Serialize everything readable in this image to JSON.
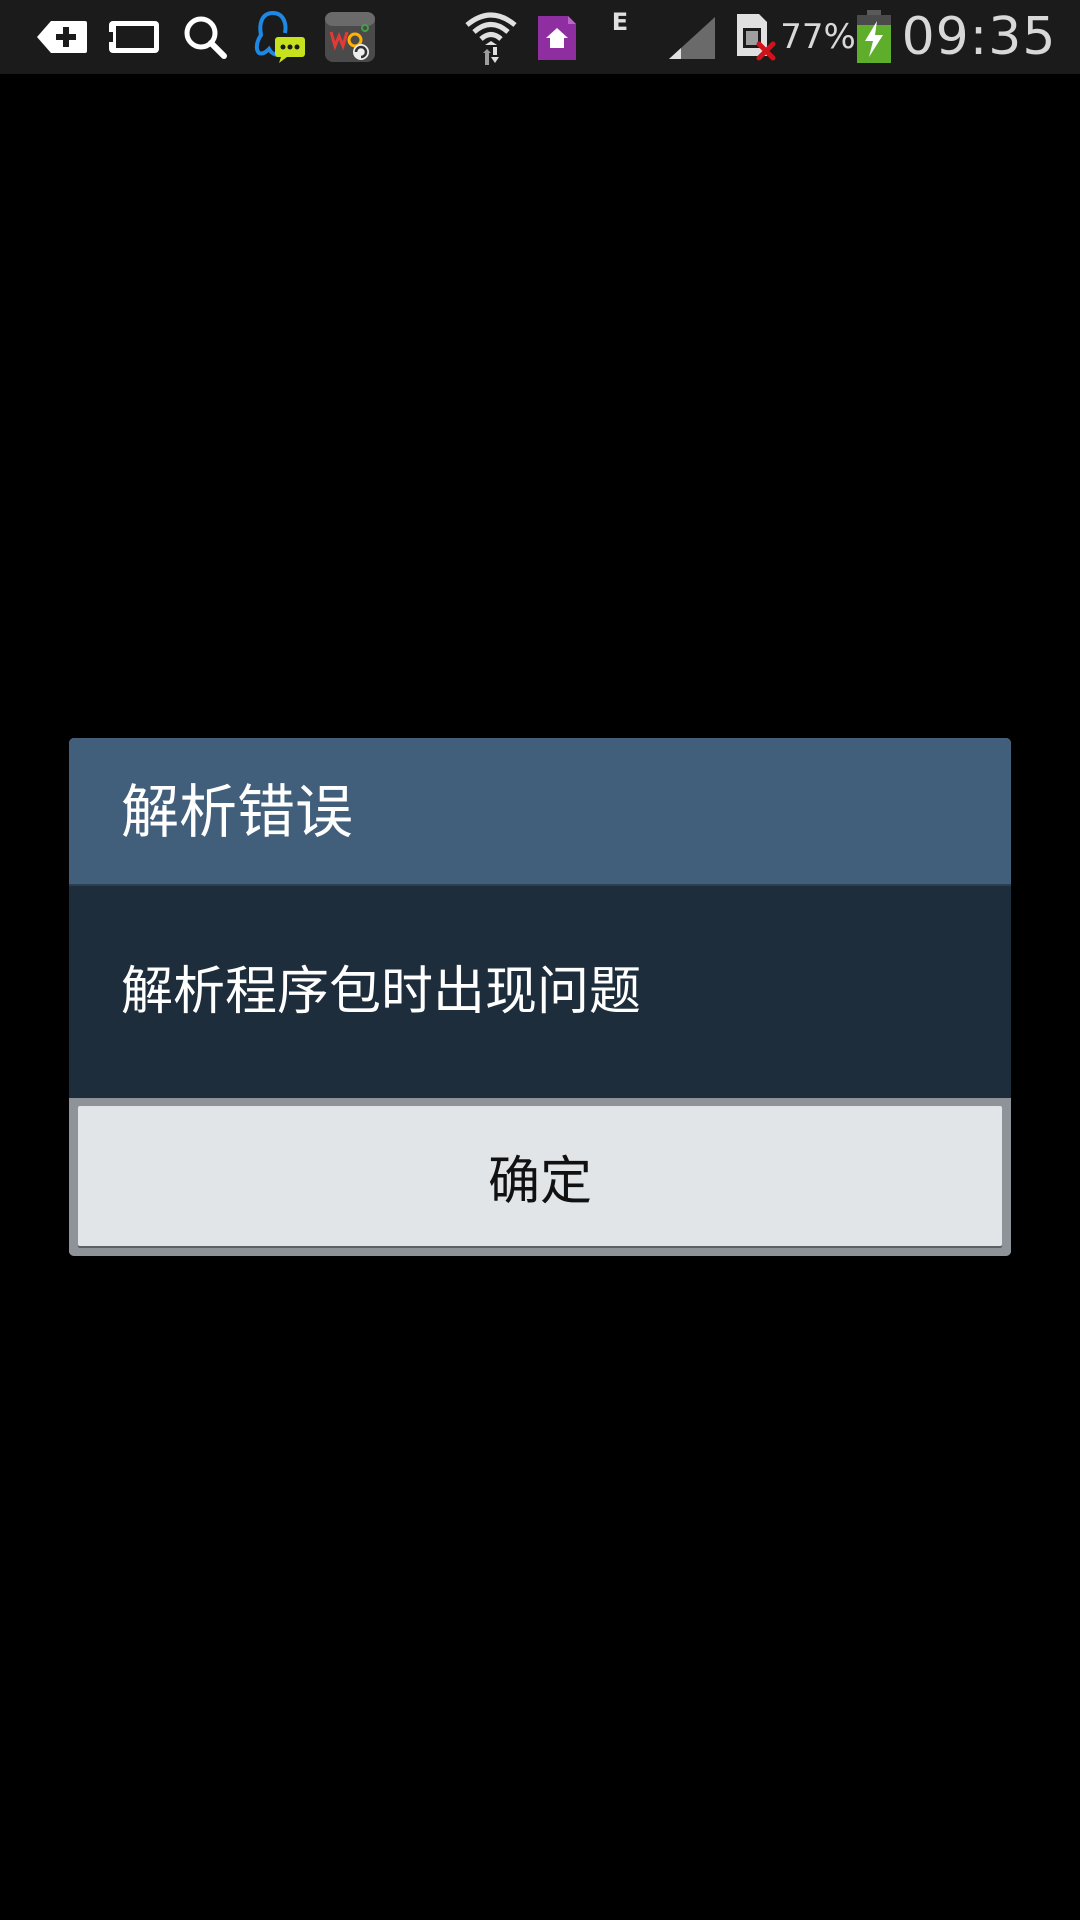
{
  "status_bar": {
    "notification_icons": [
      "add-tag-icon",
      "tablet-icon",
      "search-icon",
      "qq-chat-icon",
      "wo-store-app-icon"
    ],
    "system_icons": [
      "wifi-icon",
      "home-app-icon",
      "network-type-indicator",
      "signal-icon",
      "sim-card-error-icon",
      "battery-charging-icon"
    ],
    "network_type": "E",
    "battery_percent": "77%",
    "time": "09:35",
    "colors": {
      "background": "#1b1b1b",
      "text": "#d8d8d8",
      "qq_blue": "#1e88e5",
      "qq_bubble": "#c6e21c",
      "home_app_purple": "#8e2ea0",
      "battery_green": "#5fae2b",
      "sim_error_red": "#d0121a"
    }
  },
  "dialog": {
    "title": "解析错误",
    "message": "解析程序包时出现问题",
    "ok_button_label": "确定",
    "colors": {
      "header": "#415f7a",
      "body": "#1e2d3b",
      "footer": "#8d9398",
      "button": "#e1e5e8",
      "title_text": "#ffffff",
      "button_text": "#111111"
    }
  }
}
